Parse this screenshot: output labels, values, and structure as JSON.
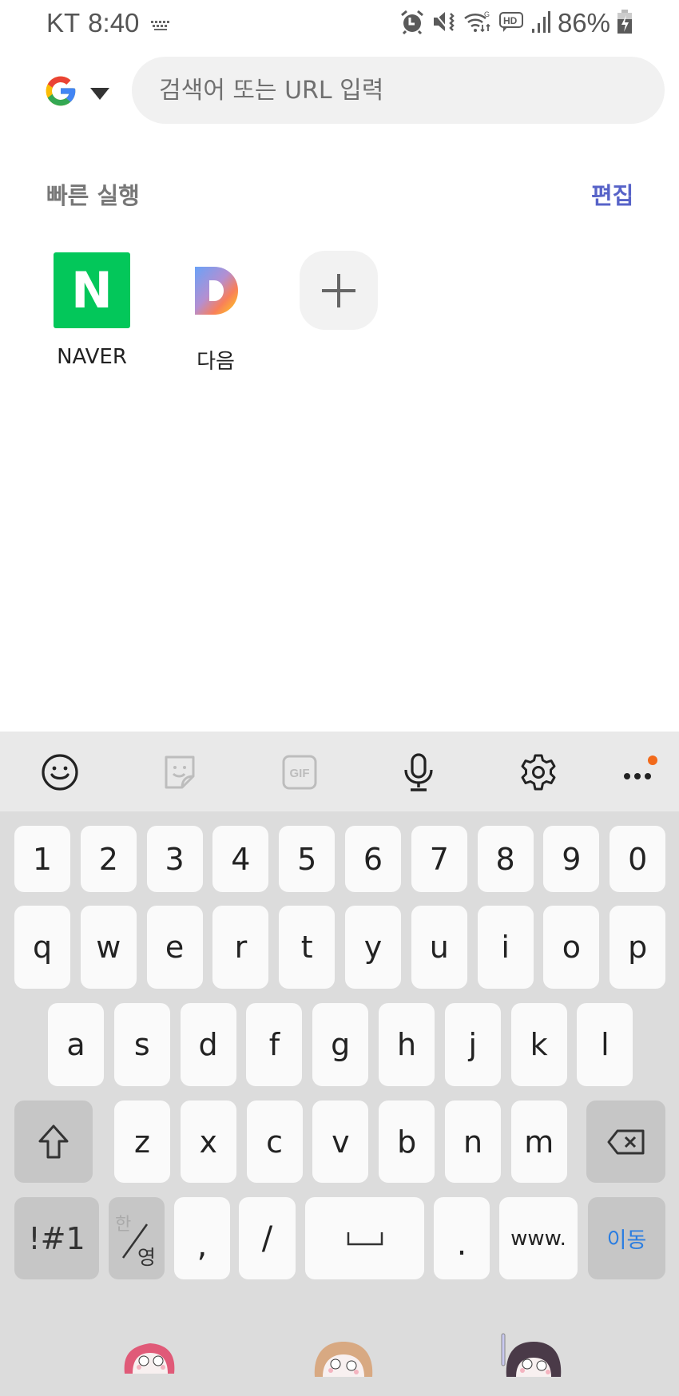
{
  "status_bar": {
    "carrier": "KT",
    "time": "8:40",
    "battery_percent": "86%",
    "icons": [
      "keyboard-icon",
      "alarm-icon",
      "mute-vibrate-icon",
      "wifi-icon",
      "hd-voice-icon",
      "signal-icon",
      "battery-charging-icon"
    ]
  },
  "browser": {
    "search_engine": "Google",
    "search_placeholder": "검색어 또는 URL 입력",
    "search_value": ""
  },
  "quick_access": {
    "title": "빠른 실행",
    "edit_label": "편집",
    "tiles": [
      {
        "label": "NAVER",
        "icon_text": "N",
        "color": "#03c75a"
      },
      {
        "label": "다음",
        "icon_text": "D"
      },
      {
        "label": "",
        "icon": "plus-icon"
      }
    ]
  },
  "keyboard": {
    "toolbar": [
      "emoji-icon",
      "sticker-icon",
      "gif-icon",
      "microphone-icon",
      "settings-icon",
      "more-icon"
    ],
    "gif_label": "GIF",
    "rows": [
      [
        "1",
        "2",
        "3",
        "4",
        "5",
        "6",
        "7",
        "8",
        "9",
        "0"
      ],
      [
        "q",
        "w",
        "e",
        "r",
        "t",
        "y",
        "u",
        "i",
        "o",
        "p"
      ],
      [
        "a",
        "s",
        "d",
        "f",
        "g",
        "h",
        "j",
        "k",
        "l"
      ],
      [
        "z",
        "x",
        "c",
        "v",
        "b",
        "n",
        "m"
      ]
    ],
    "bottom_row": {
      "symbols": "!#1",
      "lang_top": "한",
      "lang_bottom": "영",
      "comma": ",",
      "slash": "/",
      "period": ".",
      "www": "www.",
      "go": "이동"
    },
    "go_color": "#2a7de1",
    "notification_dot_color": "#f26a1b"
  }
}
